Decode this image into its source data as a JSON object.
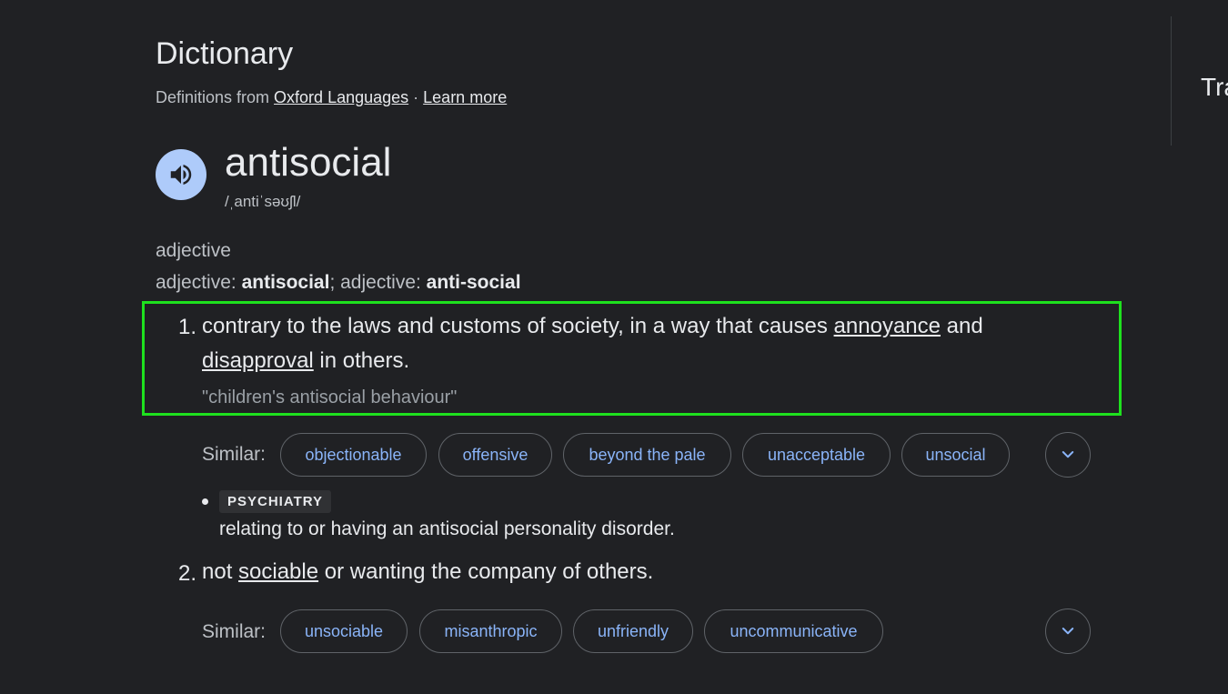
{
  "section_title": "Dictionary",
  "source": {
    "prefix": "Definitions from ",
    "provider": "Oxford Languages",
    "separator": " · ",
    "learn_more": "Learn more"
  },
  "side_label": "Tra",
  "entry": {
    "speaker_icon": "volume-up-icon",
    "headword": "antisocial",
    "phonetic": "/ˌantiˈsəʊʃl/",
    "part_of_speech": "adjective",
    "forms": {
      "pos1": "adjective",
      "word1": "antisocial",
      "pos2": "adjective",
      "word2": "anti-social"
    }
  },
  "senses": [
    {
      "number": "1.",
      "text_a": "contrary to the laws and customs of society, in a way that causes ",
      "link_a": "annoyance",
      "text_b": " and ",
      "link_b": "disapproval",
      "text_c": " in others.",
      "example": "\"children's antisocial behaviour\"",
      "similar_label": "Similar:",
      "similar": [
        "objectionable",
        "offensive",
        "beyond the pale",
        "unacceptable",
        "unsocial"
      ],
      "subsense": {
        "label": "PSYCHIATRY",
        "text": "relating to or having an antisocial personality disorder."
      }
    },
    {
      "number": "2.",
      "text_a": "not ",
      "link_a": "sociable",
      "text_b": " or wanting the company of others.",
      "similar_label": "Similar:",
      "similar": [
        "unsociable",
        "misanthropic",
        "unfriendly",
        "uncommunicative"
      ]
    }
  ],
  "colors": {
    "background": "#202124",
    "accent_link": "#8ab4f8",
    "speaker_bg": "#aecbfa",
    "highlight_border": "#1ee11e"
  }
}
